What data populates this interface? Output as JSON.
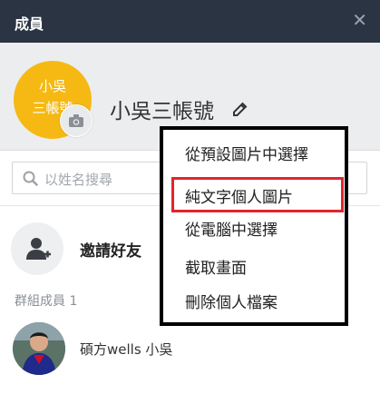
{
  "header": {
    "title": "成員"
  },
  "profile": {
    "avatar_text_line1": "小吳",
    "avatar_text_line2": "三帳號",
    "name": "小吳三帳號"
  },
  "search": {
    "placeholder": "以姓名搜尋"
  },
  "invite": {
    "label": "邀請好友"
  },
  "members": {
    "group_label": "群組成員 1",
    "items": [
      {
        "name": "碩方wells 小吳"
      }
    ]
  },
  "menu": {
    "items": [
      {
        "label": "從預設圖片中選擇"
      },
      {
        "label": "純文字個人圖片"
      },
      {
        "label": "從電腦中選擇"
      },
      {
        "label": "截取畫面"
      },
      {
        "label": "刪除個人檔案"
      }
    ]
  },
  "colors": {
    "header_bg": "#2b3442",
    "avatar_bg": "#f6b913",
    "highlight": "#e3242b"
  }
}
